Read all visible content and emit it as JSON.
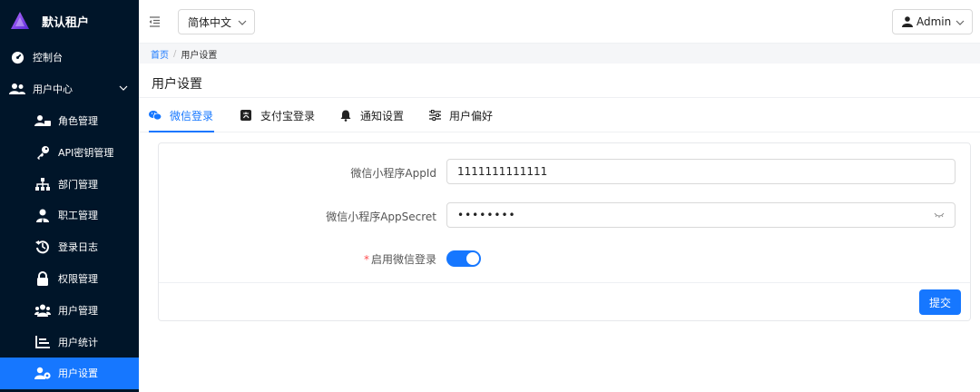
{
  "brand": {
    "name": "默认租户"
  },
  "sidebar": {
    "items": [
      {
        "label": "控制台",
        "icon": "dashboard-icon"
      },
      {
        "label": "用户中心",
        "icon": "users-icon"
      },
      {
        "label": "角色管理",
        "icon": "role-icon"
      },
      {
        "label": "API密钥管理",
        "icon": "key-icon"
      },
      {
        "label": "部门管理",
        "icon": "org-tree-icon"
      },
      {
        "label": "职工管理",
        "icon": "employee-icon"
      },
      {
        "label": "登录日志",
        "icon": "history-icon"
      },
      {
        "label": "权限管理",
        "icon": "lock-icon"
      },
      {
        "label": "用户管理",
        "icon": "user-group-icon"
      },
      {
        "label": "用户统计",
        "icon": "bar-chart-icon"
      },
      {
        "label": "用户设置",
        "icon": "user-settings-icon"
      }
    ],
    "active_color": "#1677ff",
    "bg_color": "#001529"
  },
  "header": {
    "language": "简体中文",
    "user": "Admin"
  },
  "breadcrumb": {
    "home": "首页",
    "separator": "/",
    "current": "用户设置"
  },
  "page": {
    "title": "用户设置"
  },
  "tabs": [
    {
      "label": "微信登录",
      "icon": "wechat-icon"
    },
    {
      "label": "支付宝登录",
      "icon": "alipay-icon"
    },
    {
      "label": "通知设置",
      "icon": "bell-icon"
    },
    {
      "label": "用户偏好",
      "icon": "sliders-icon"
    }
  ],
  "form": {
    "appid": {
      "label": "微信小程序AppId",
      "value": "1111111111111"
    },
    "appsecret": {
      "label": "微信小程序AppSecret",
      "value": "••••••••"
    },
    "enable": {
      "required_mark": "*",
      "label": "启用微信登录",
      "checked": true
    },
    "submit_label": "提交"
  }
}
